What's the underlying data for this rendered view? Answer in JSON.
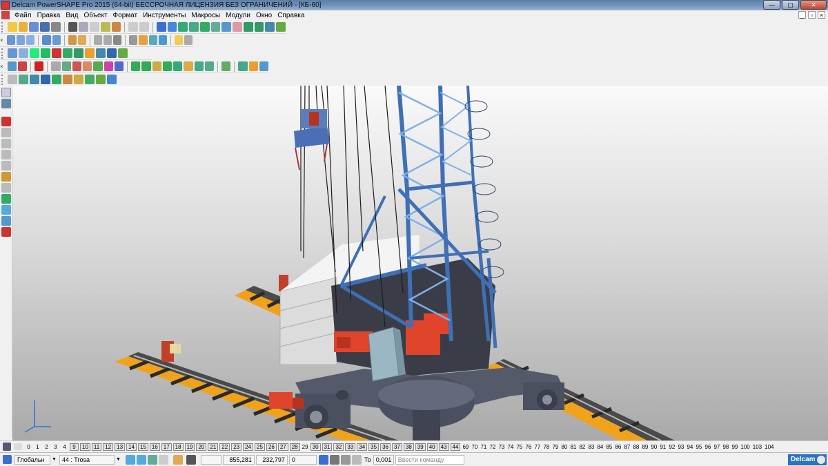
{
  "window": {
    "title": "Delcam PowerSHAPE Pro 2015 (64-bit) БЕССРОЧНАЯ ЛИЦЕНЗИЯ БЕЗ ОГРАНИЧЕНИЙ - [КБ-60]"
  },
  "menu": {
    "items": [
      "Файл",
      "Правка",
      "Вид",
      "Объект",
      "Формат",
      "Инструменты",
      "Макросы",
      "Модули",
      "Окно",
      "Справка"
    ]
  },
  "levels": {
    "items": [
      "0",
      "1",
      "2",
      "3",
      "4",
      "9",
      "10",
      "11",
      "12",
      "13",
      "14",
      "15",
      "16",
      "17",
      "18",
      "19",
      "20",
      "21",
      "22",
      "23",
      "24",
      "25",
      "26",
      "27",
      "28",
      "29",
      "30",
      "31",
      "32",
      "33",
      "34",
      "35",
      "36",
      "37",
      "38",
      "39",
      "40",
      "43",
      "44",
      "69",
      "70",
      "71",
      "72",
      "73",
      "74",
      "75",
      "76",
      "77",
      "78",
      "79",
      "80",
      "81",
      "82",
      "83",
      "84",
      "85",
      "86",
      "87",
      "88",
      "89",
      "90",
      "91",
      "92",
      "93",
      "94",
      "95",
      "96",
      "97",
      "98",
      "99",
      "100",
      "103",
      "104"
    ],
    "boxed": [
      "9",
      "10",
      "11",
      "12",
      "13",
      "14",
      "15",
      "16",
      "17",
      "18",
      "19",
      "20",
      "21",
      "22",
      "23",
      "24",
      "25",
      "26",
      "27",
      "28",
      "30",
      "31",
      "32",
      "33",
      "34",
      "35",
      "36",
      "37",
      "38",
      "39",
      "40",
      "43",
      "44"
    ]
  },
  "status": {
    "workplane": "Глобальн",
    "level": "44 : Trosa",
    "x": "855,281",
    "y": "232,797",
    "z": "0",
    "tolerance_label": "То",
    "tolerance": "0,001",
    "command_placeholder": "Ввести команду",
    "brand": "Delcam"
  },
  "scene": {
    "colors": {
      "crane_blue": "#3f6fb5",
      "crane_light": "#7fb0ea",
      "counterweight": "#e9e9ea",
      "motor": "#e0442a",
      "rail_orange": "#f0a21c",
      "base": "#555a6b",
      "cabinet": "#9bb7c4"
    }
  }
}
